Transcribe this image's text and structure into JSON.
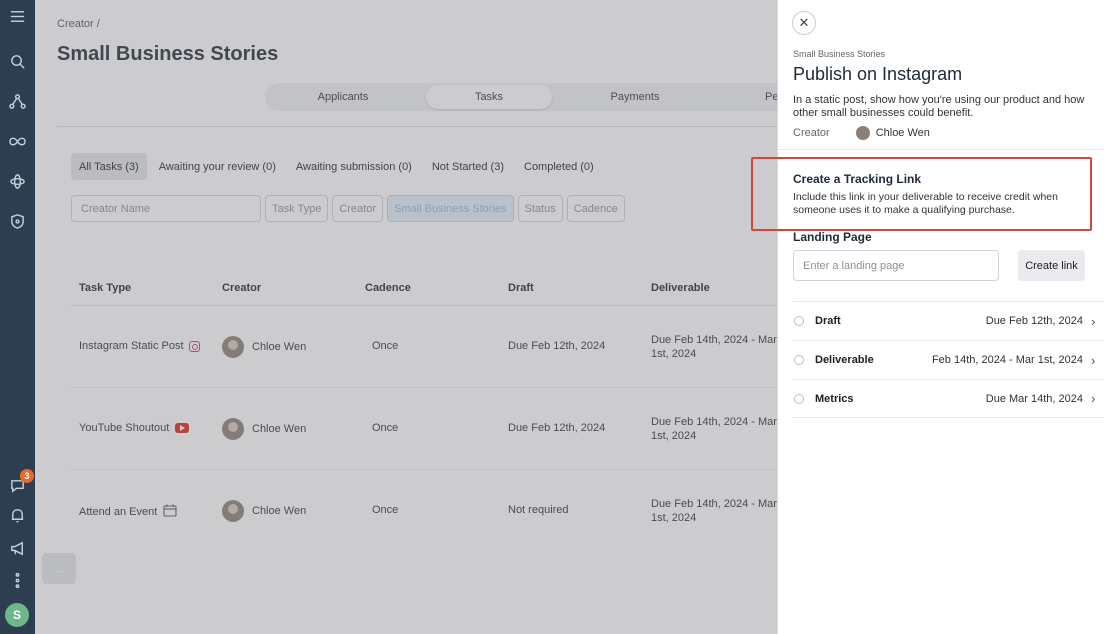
{
  "rail": {
    "icons": [
      "menu-icon",
      "search-icon",
      "network-icon",
      "infinity-icon",
      "atom-icon",
      "shield-icon"
    ],
    "chat_badge": "3",
    "user_initial": "S"
  },
  "main": {
    "breadcrumb": "Creator /",
    "title": "Small Business Stories",
    "tabs": [
      {
        "label": "Applicants",
        "active": false
      },
      {
        "label": "Tasks",
        "active": true
      },
      {
        "label": "Payments",
        "active": false
      },
      {
        "label": "Pe",
        "active": false
      }
    ],
    "filter_chips": [
      {
        "label": "All Tasks (3)",
        "active": true
      },
      {
        "label": "Awaiting your review (0)",
        "active": false
      },
      {
        "label": "Awaiting submission (0)",
        "active": false
      },
      {
        "label": "Not Started (3)",
        "active": false
      },
      {
        "label": "Completed (0)",
        "active": false
      }
    ],
    "search": {
      "placeholder": "Creator Name",
      "facets": [
        "Task Type",
        "Creator",
        "Small Business Stories",
        "Status",
        "Cadence"
      ]
    },
    "table": {
      "headers": [
        "Task Type",
        "Creator",
        "Cadence",
        "Draft",
        "Deliverable"
      ],
      "rows": [
        {
          "task_type": "Instagram Static Post",
          "icon": "instagram-icon",
          "creator": "Chloe Wen",
          "cadence": "Once",
          "draft": "Due Feb 12th, 2024",
          "deliverable": "Due Feb 14th, 2024 - Mar 1st, 2024"
        },
        {
          "task_type": "YouTube Shoutout",
          "icon": "youtube-icon",
          "creator": "Chloe Wen",
          "cadence": "Once",
          "draft": "Due Feb 12th, 2024",
          "deliverable": "Due Feb 14th, 2024 - Mar 1st, 2024"
        },
        {
          "task_type": "Attend an Event",
          "icon": "calendar-icon",
          "creator": "Chloe Wen",
          "cadence": "Once",
          "draft": "Not required",
          "deliverable": "Due Feb 14th, 2024 - Mar 1st, 2024"
        }
      ]
    }
  },
  "panel": {
    "subtitle": "Small Business Stories",
    "title": "Publish on Instagram",
    "description": "In a static post, show how you're using our product and how other small businesses could benefit.",
    "creator_label": "Creator",
    "creator_name": "Chloe Wen",
    "tracking": {
      "title": "Create a Tracking Link",
      "description": "Include this link in your deliverable to receive credit when someone uses it to make a qualifying purchase.",
      "highlight_color": "#d9443a"
    },
    "landing_page": {
      "title": "Landing Page",
      "placeholder": "Enter a landing page",
      "button": "Create link"
    },
    "steps": [
      {
        "label": "Draft",
        "date": "Due Feb 12th, 2024"
      },
      {
        "label": "Deliverable",
        "date": "Feb 14th, 2024 - Mar 1st, 2024"
      },
      {
        "label": "Metrics",
        "date": "Due Mar 14th, 2024"
      }
    ]
  }
}
